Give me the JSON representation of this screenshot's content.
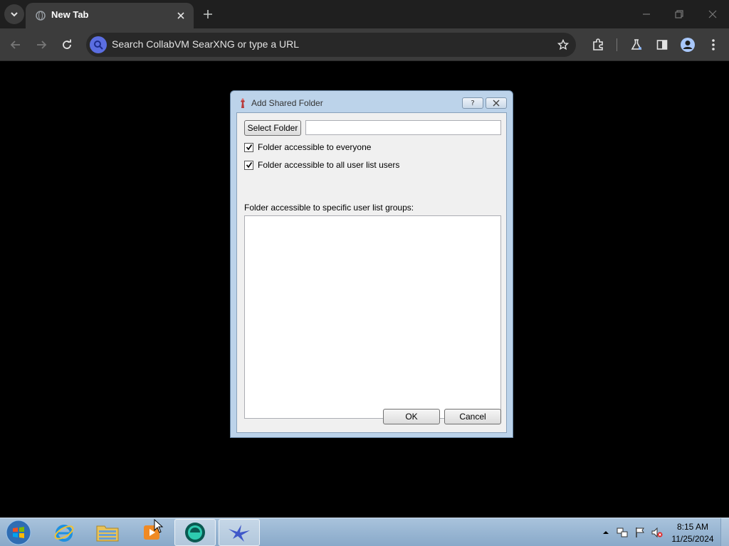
{
  "browser": {
    "tab_title": "New Tab",
    "omnibox_placeholder": "Search CollabVM SearXNG or type a URL"
  },
  "dialog": {
    "title": "Add Shared Folder",
    "help_glyph": "?",
    "select_folder_label": "Select Folder",
    "folder_path_value": "",
    "checkbox_everyone": {
      "label": "Folder accessible to everyone",
      "checked": true
    },
    "checkbox_all_users": {
      "label": "Folder accessible to all user list users",
      "checked": true
    },
    "groups_label": "Folder accessible to specific user list groups:",
    "groups_list": [],
    "ok_label": "OK",
    "cancel_label": "Cancel"
  },
  "taskbar": {
    "apps": [
      {
        "name": "internet-explorer",
        "active": false
      },
      {
        "name": "windows-explorer",
        "active": false
      },
      {
        "name": "media-player",
        "active": false
      },
      {
        "name": "browser",
        "active": true
      },
      {
        "name": "bird-app",
        "active": true
      }
    ],
    "clock_time": "8:15 AM",
    "clock_date": "11/25/2024"
  }
}
